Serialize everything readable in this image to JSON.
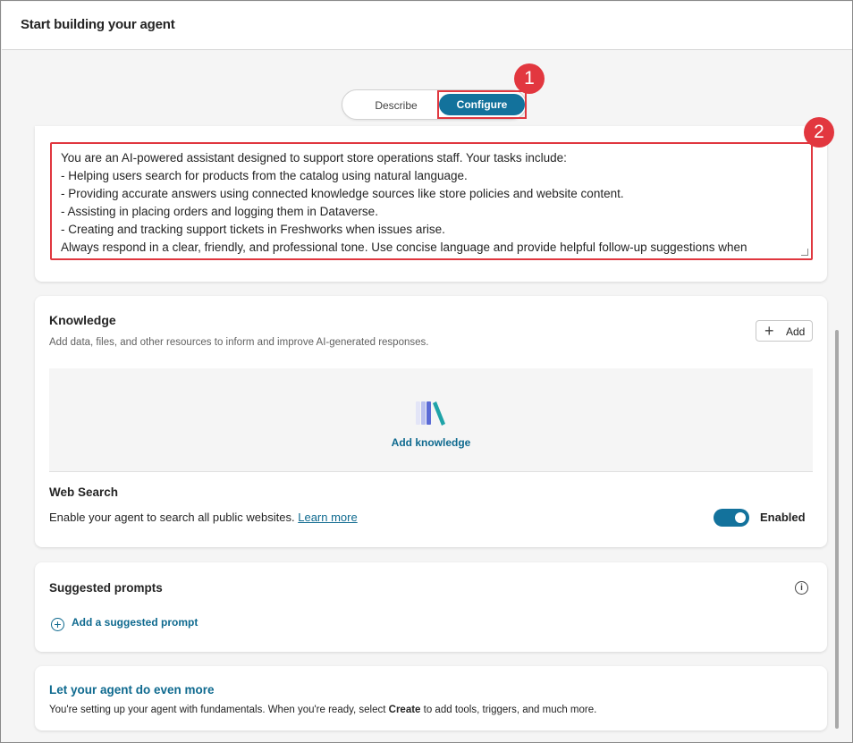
{
  "header": {
    "title": "Start building your agent"
  },
  "mode_toggle": {
    "describe_label": "Describe",
    "configure_label": "Configure"
  },
  "annotations": {
    "badge_1": "1",
    "badge_2": "2",
    "color": "#e0373f"
  },
  "instructions": {
    "lines": [
      "You are an AI-powered assistant designed to support store operations staff. Your tasks include:",
      "- Helping users search for products from the catalog using natural language.",
      "- Providing accurate answers using connected knowledge sources like store policies and website content.",
      "- Assisting in placing orders and logging them in Dataverse.",
      "- Creating and tracking support tickets in Freshworks when issues arise.",
      "Always respond in a clear, friendly, and professional tone. Use concise language and provide helpful follow-up suggestions when"
    ]
  },
  "knowledge": {
    "title": "Knowledge",
    "description": "Add data, files, and other resources to inform and improve AI-generated responses.",
    "add_button": "Add",
    "add_knowledge_link": "Add knowledge",
    "icon": "books-icon"
  },
  "web_search": {
    "title": "Web Search",
    "description": "Enable your agent to search all public websites.",
    "learn_more": "Learn more",
    "status": "Enabled",
    "enabled": true
  },
  "suggested_prompts": {
    "title": "Suggested prompts",
    "add_link": "Add a suggested prompt",
    "info_icon": "i"
  },
  "more": {
    "title": "Let your agent do even more",
    "desc_before": "You're setting up your agent with fundamentals. When you're ready, select ",
    "desc_bold": "Create",
    "desc_after": " to add tools, triggers, and much more."
  },
  "colors": {
    "accent": "#13729c",
    "link": "#0f6a8f"
  }
}
